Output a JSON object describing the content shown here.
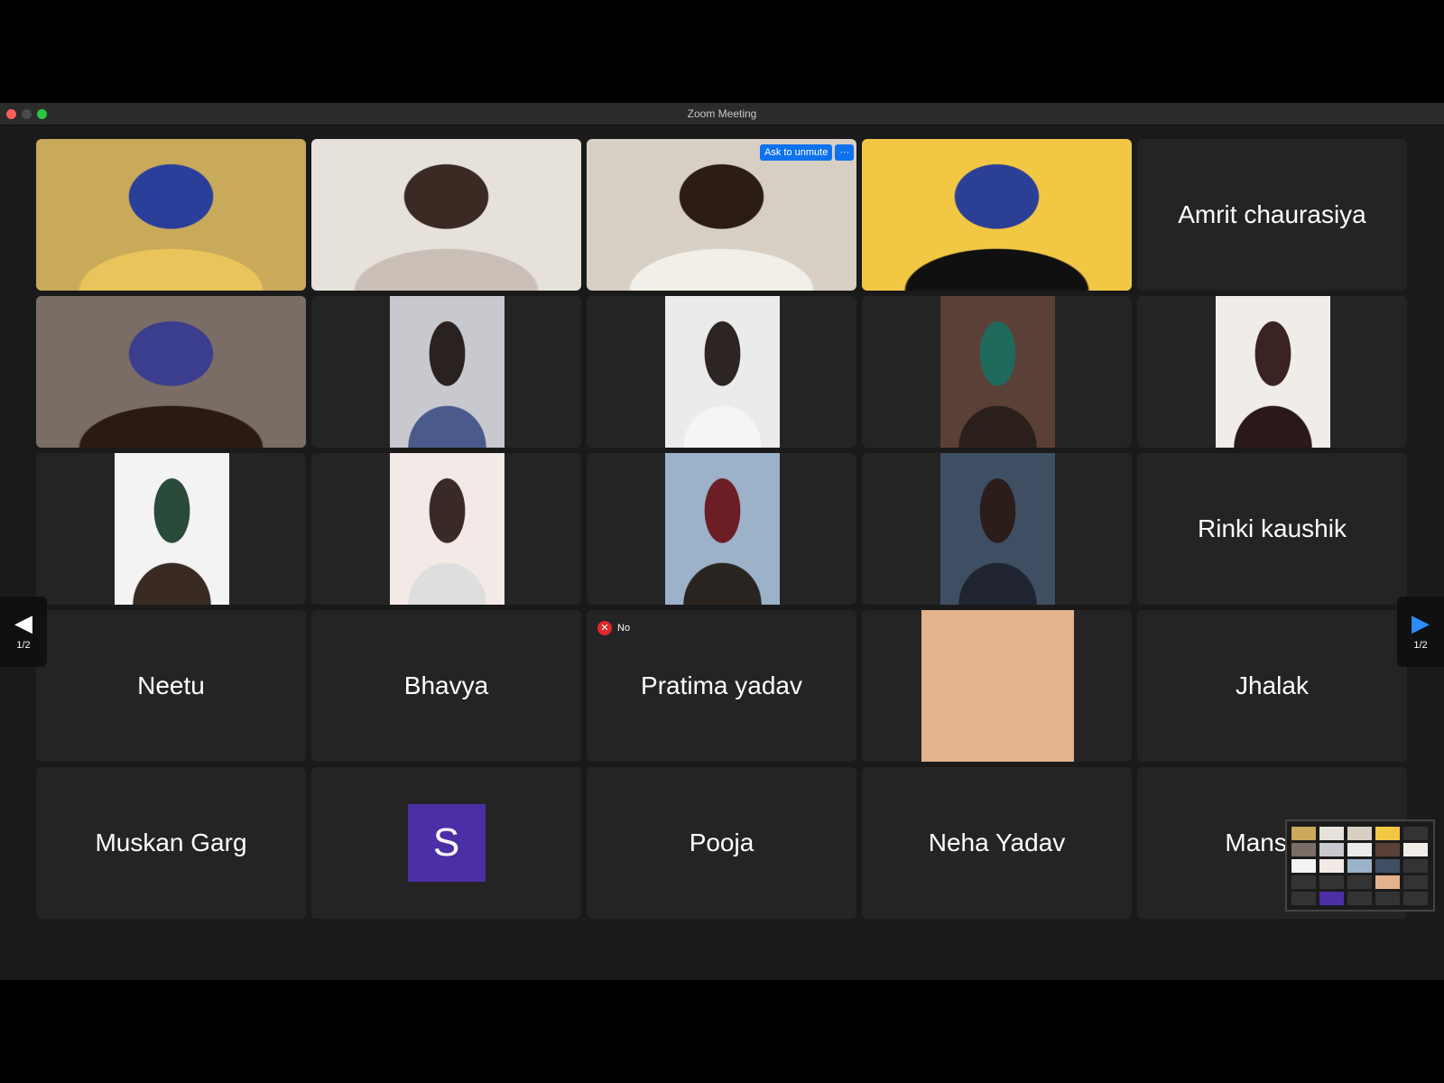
{
  "window": {
    "title": "Zoom Meeting"
  },
  "tiles": [
    {
      "type": "video",
      "fit": "full",
      "colors": [
        "#c9a95a",
        "#2a3f9a",
        "#e8c45a"
      ]
    },
    {
      "type": "video",
      "fit": "full",
      "colors": [
        "#e7e1db",
        "#3b2a24",
        "#c9bfb7"
      ]
    },
    {
      "type": "video",
      "fit": "full",
      "colors": [
        "#d8cfc4",
        "#2b1d14",
        "#f2efe9"
      ],
      "overlay": "unmute"
    },
    {
      "type": "video",
      "fit": "full",
      "colors": [
        "#f2c744",
        "#2c3f96",
        "#101010"
      ]
    },
    {
      "type": "name",
      "name": "Amrit chaurasiya"
    },
    {
      "type": "video",
      "fit": "full",
      "colors": [
        "#7a6d65",
        "#3b3e8c",
        "#2a1a12"
      ],
      "active": true
    },
    {
      "type": "video",
      "fit": "narrow",
      "colors": [
        "#c7c9cf",
        "#2a2220",
        "#4a5a8a"
      ]
    },
    {
      "type": "video",
      "fit": "narrow",
      "colors": [
        "#ebebeb",
        "#2d2523",
        "#f5f5f5"
      ]
    },
    {
      "type": "video",
      "fit": "narrow",
      "colors": [
        "#5a4036",
        "#1f6a5a",
        "#2b1f1b"
      ]
    },
    {
      "type": "video",
      "fit": "narrow",
      "colors": [
        "#f0ede8",
        "#3a2320",
        "#2b1818"
      ]
    },
    {
      "type": "video",
      "fit": "narrow",
      "colors": [
        "#f3f3f3",
        "#2a4a3a",
        "#3a2a24"
      ]
    },
    {
      "type": "video",
      "fit": "narrow",
      "colors": [
        "#f3e9e6",
        "#3a2a26",
        "#dedede"
      ]
    },
    {
      "type": "video",
      "fit": "narrow",
      "colors": [
        "#9bb2c9",
        "#6b1f24",
        "#2a2420"
      ]
    },
    {
      "type": "video",
      "fit": "narrow",
      "colors": [
        "#3f4f63",
        "#2a1d1a",
        "#1f2430"
      ]
    },
    {
      "type": "name",
      "name": "Rinki kaushik"
    },
    {
      "type": "name",
      "name": "Neetu"
    },
    {
      "type": "name",
      "name": "Bhavya"
    },
    {
      "type": "name",
      "name": "Pratima yadav",
      "overlay": "no"
    },
    {
      "type": "beige",
      "colors": [
        "#e3b28e"
      ]
    },
    {
      "type": "name",
      "name": "Jhalak"
    },
    {
      "type": "name",
      "name": "Muskan Garg"
    },
    {
      "type": "avatar",
      "letter": "S",
      "colors": [
        "#4c2fa6"
      ]
    },
    {
      "type": "name",
      "name": "Pooja"
    },
    {
      "type": "name",
      "name": "Neha Yadav"
    },
    {
      "type": "name",
      "name": "Mansi Ti"
    }
  ],
  "overlays": {
    "unmute": {
      "label": "Ask to unmute",
      "more": "···"
    },
    "no": {
      "icon": "✕",
      "label": "No"
    }
  },
  "pager": {
    "left_arrow": "◀",
    "right_arrow": "▶",
    "count": "1/2"
  },
  "icons": {
    "prev": "chevron-left-icon",
    "next": "chevron-right-icon"
  }
}
